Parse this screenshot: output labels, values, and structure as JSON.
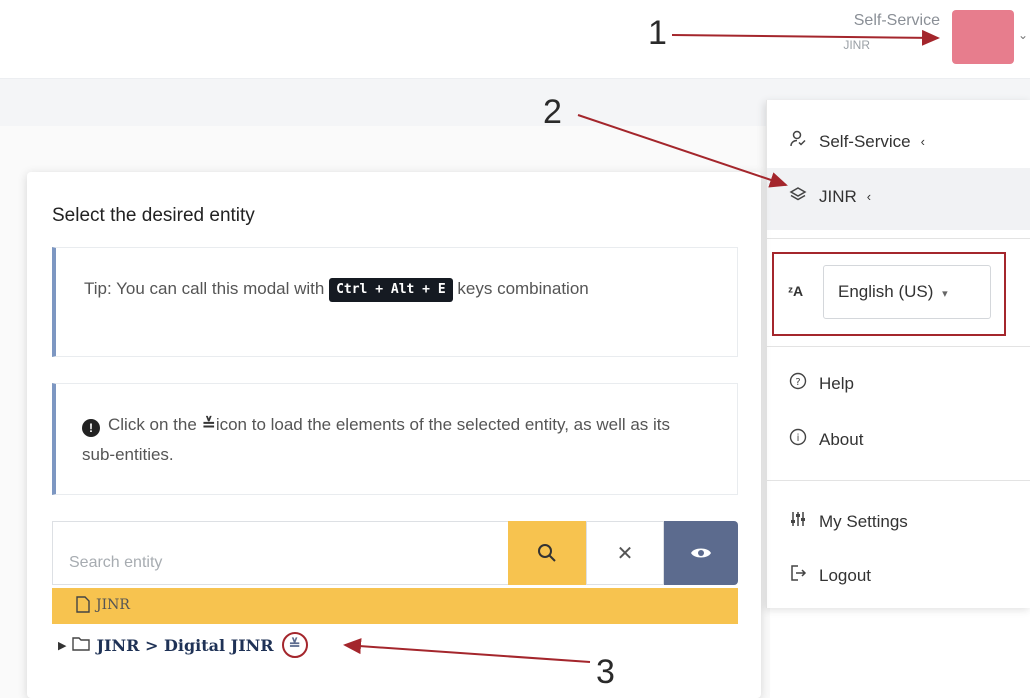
{
  "header": {
    "user_name": "Self-Service",
    "user_org": "JINR"
  },
  "dropdown_menu": {
    "self_service_label": "Self-Service",
    "jinr_label": "JINR",
    "language": {
      "selected": "English (US)"
    },
    "help_label": "Help",
    "about_label": "About",
    "settings_label": "My Settings",
    "logout_label": "Logout"
  },
  "modal": {
    "title": "Select the desired entity",
    "tip_prefix": "Tip: You can call this modal with",
    "tip_shortcut": "Ctrl + Alt + E",
    "tip_suffix": "keys combination",
    "info_prefix": "Click on the",
    "info_suffix": "icon to load the elements of the selected entity, as well as its sub-entities.",
    "search_placeholder": "Search entity",
    "tree": {
      "selected_node": "JINR",
      "child_node": "JINR > Digital JINR"
    }
  },
  "annotations": {
    "one": "1",
    "two": "2",
    "three": "3"
  },
  "colors": {
    "accent_yellow": "#f7c34f",
    "slate_button": "#5c6b8e",
    "annotation_red": "#a4262c",
    "avatar_pink": "#e77d8d"
  }
}
